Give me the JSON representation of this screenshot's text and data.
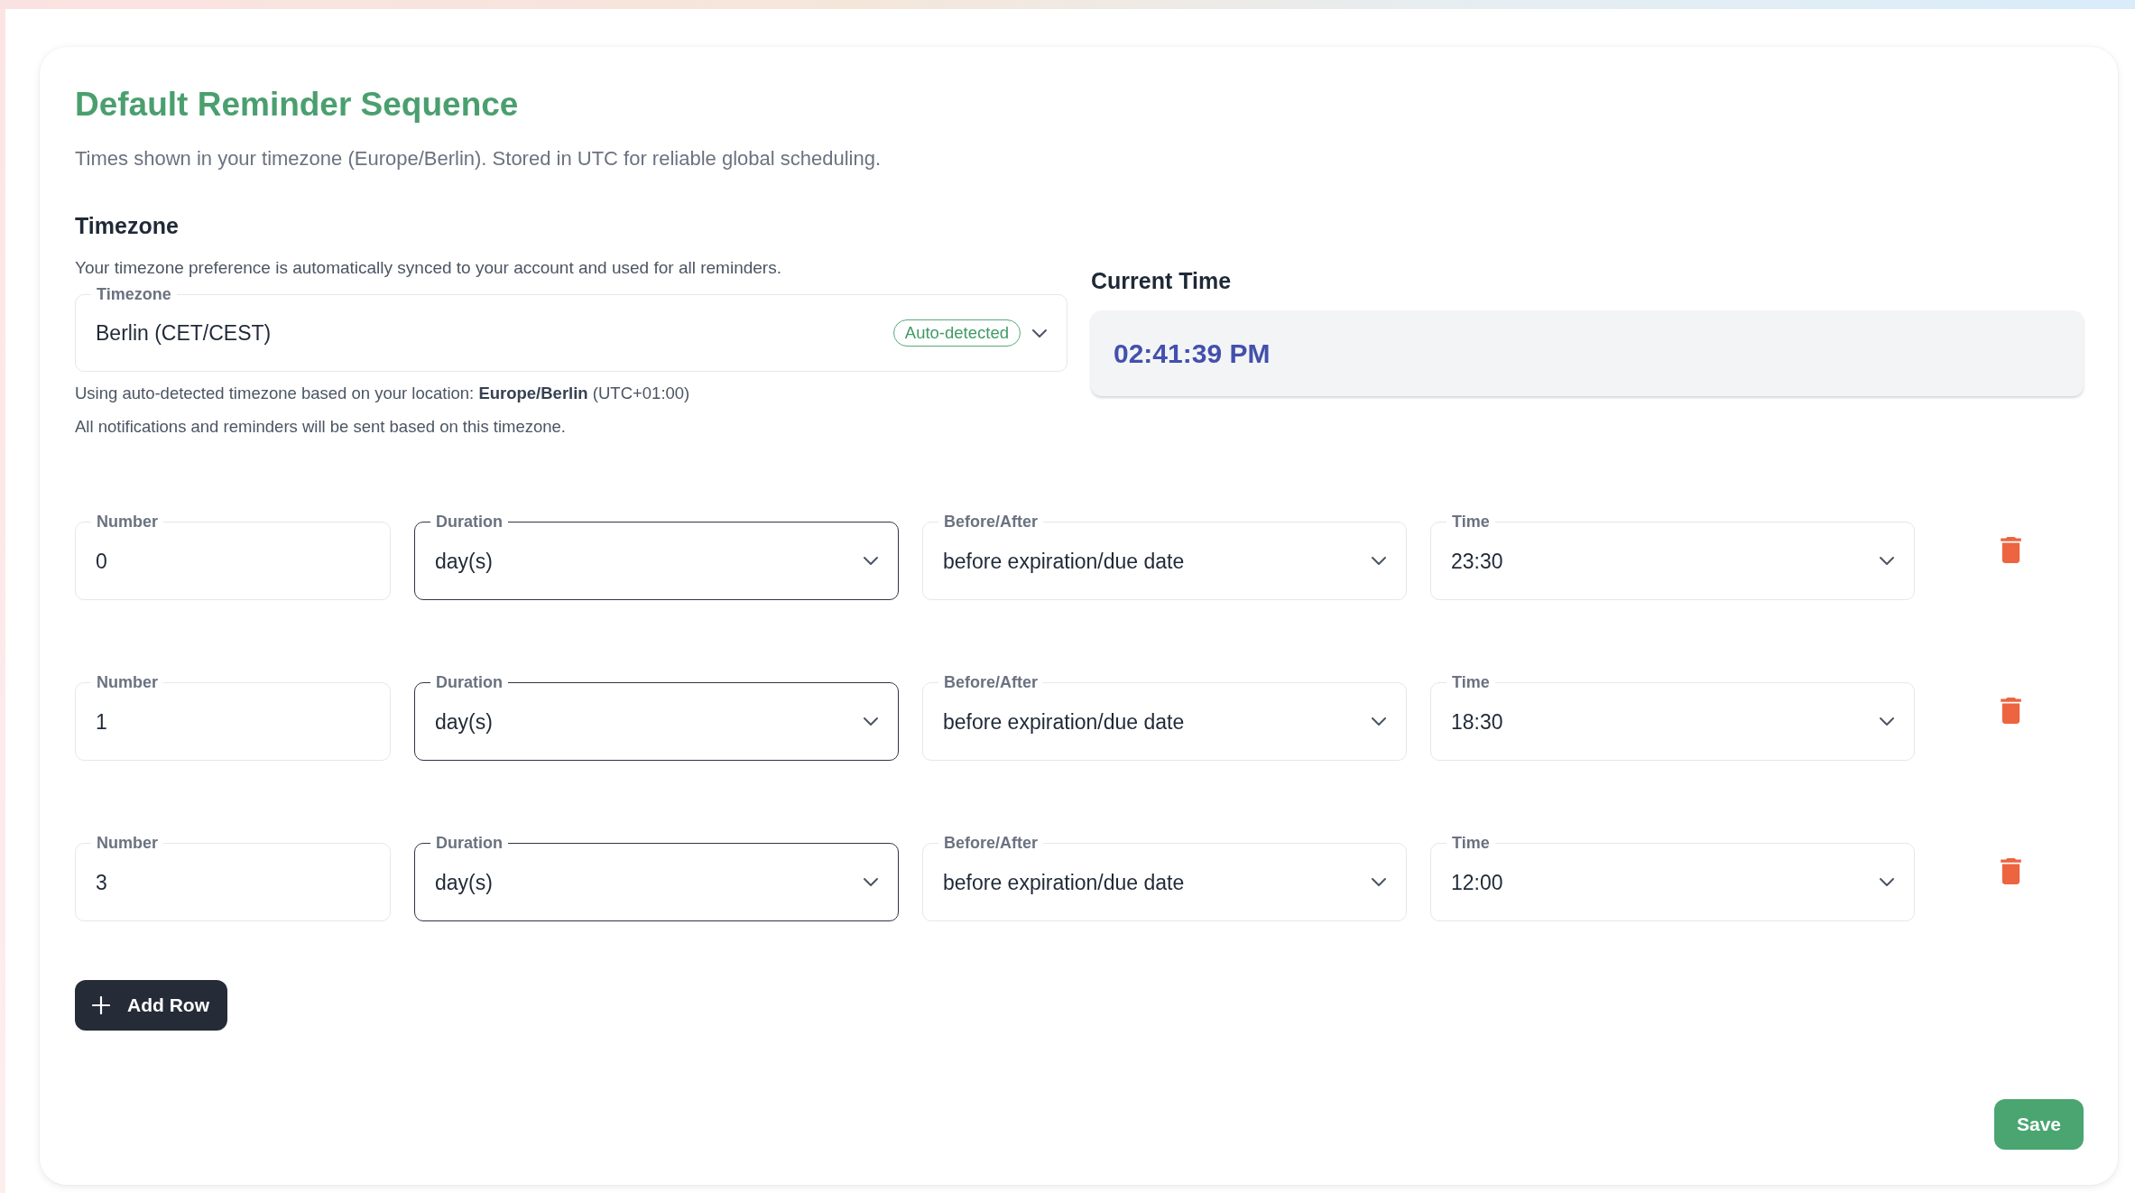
{
  "title": "Default Reminder Sequence",
  "subtitle": "Times shown in your timezone (Europe/Berlin). Stored in UTC for reliable global scheduling.",
  "timezone_section": {
    "heading": "Timezone",
    "description": "Your timezone preference is automatically synced to your account and used for all reminders.",
    "field": {
      "label": "Timezone",
      "value": "Berlin (CET/CEST)",
      "badge": "Auto-detected"
    },
    "notes": [
      "Using auto-detected timezone based on your location: **Europe/Berlin** (UTC+01:00)",
      "All notifications and reminders will be sent based on this timezone."
    ]
  },
  "current_time": {
    "heading": "Current Time",
    "value": "02:41:39 PM"
  },
  "reminder_rows": [
    {
      "fields": [
        {
          "kind": "input",
          "label": "Number",
          "value": "0"
        },
        {
          "kind": "outlined",
          "label": "Duration",
          "value": "day(s)"
        },
        {
          "kind": "select",
          "label": "Before/After",
          "value": "before expiration/due date"
        },
        {
          "kind": "select",
          "label": "Time",
          "value": "23:30"
        }
      ]
    },
    {
      "fields": [
        {
          "kind": "input",
          "label": "Number",
          "value": "1"
        },
        {
          "kind": "outlined",
          "label": "Duration",
          "value": "day(s)"
        },
        {
          "kind": "select",
          "label": "Before/After",
          "value": "before expiration/due date"
        },
        {
          "kind": "select",
          "label": "Time",
          "value": "18:30"
        }
      ]
    },
    {
      "fields": [
        {
          "kind": "input",
          "label": "Number",
          "value": "3"
        },
        {
          "kind": "outlined",
          "label": "Duration",
          "value": "day(s)"
        },
        {
          "kind": "select",
          "label": "Before/After",
          "value": "before expiration/due date"
        },
        {
          "kind": "select",
          "label": "Time",
          "value": "12:00"
        }
      ]
    }
  ],
  "buttons": {
    "add_row": "Add Row",
    "save": "Save"
  }
}
